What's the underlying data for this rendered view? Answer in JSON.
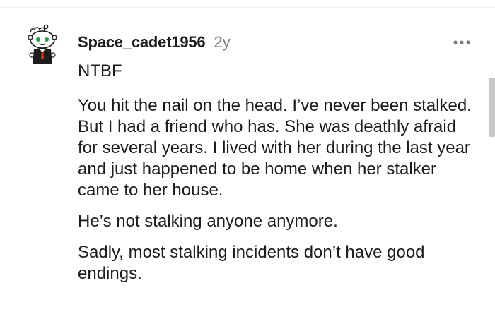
{
  "comment": {
    "username": "Space_cadet1956",
    "timestamp": "2y",
    "flair": "NTBF",
    "paragraphs": [
      "You hit the nail on the head. I’ve never been stalked. But I had a friend who has. She was deathly afraid for several years. I lived with her during the last year and just happened to be home when her stalker came to her house.",
      "He’s not stalking anyone anymore.",
      "Sadly, most stalking incidents don’t have good endings."
    ],
    "avatar_icon": "snoo-avatar-icon",
    "more_icon": "more-options-icon"
  },
  "colors": {
    "text": "#1c1c1c",
    "meta": "#7c7c7c",
    "background": "#ffffff",
    "scrollbar": "#c7c7c7"
  }
}
